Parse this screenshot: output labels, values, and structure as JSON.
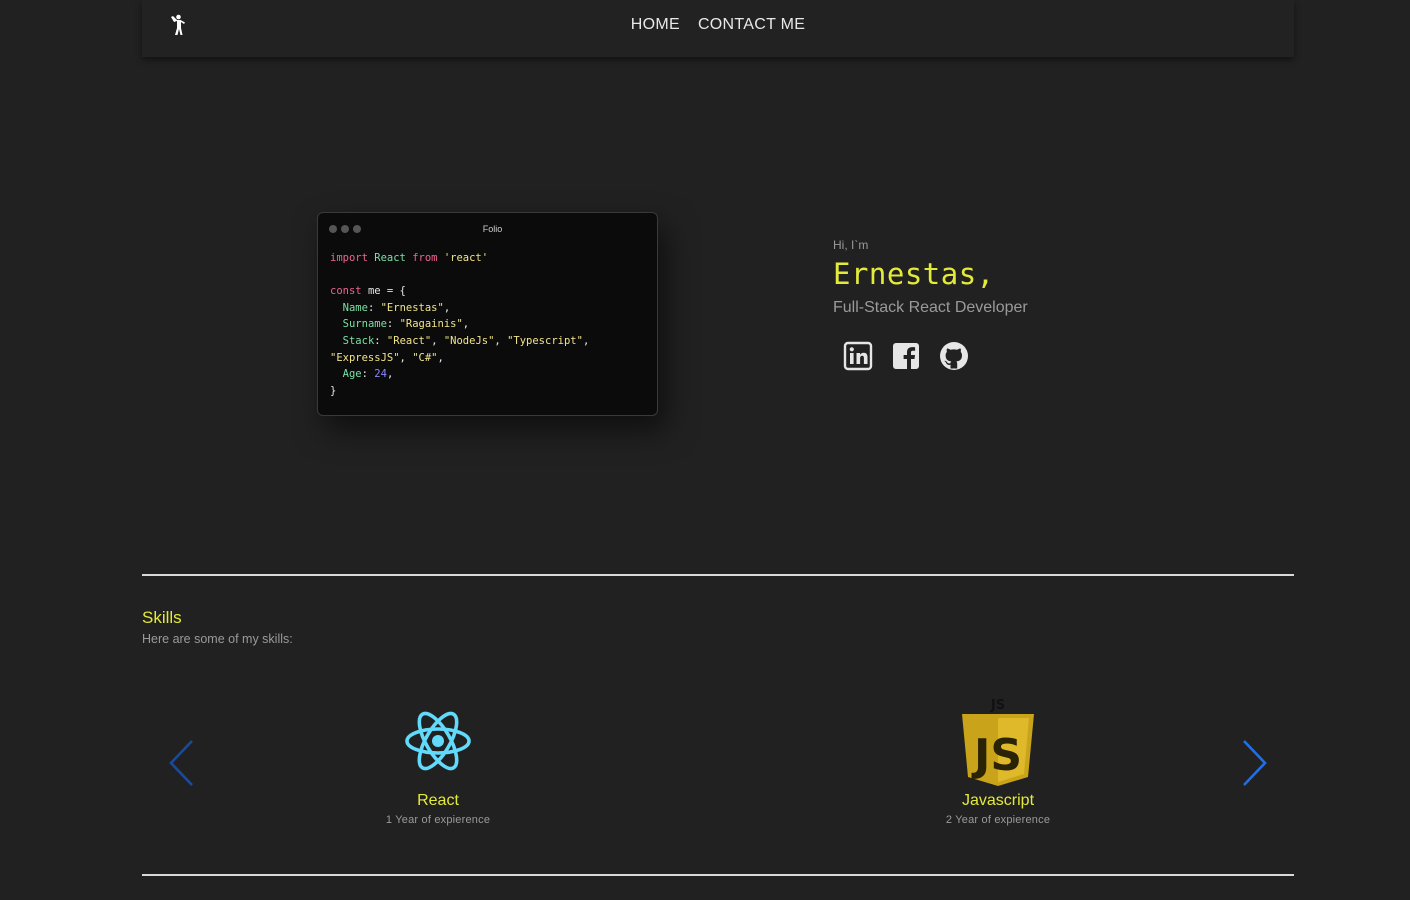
{
  "nav": {
    "logo_icon": "dancing-person-icon",
    "links": [
      {
        "label": "HOME"
      },
      {
        "label": "CONTACT ME"
      }
    ]
  },
  "code_window": {
    "title": "Folio",
    "lines": {
      "import_kw": "import",
      "import_name": "React",
      "from_kw": "from",
      "import_path": "'react'",
      "const_kw": "const",
      "var_name": "me",
      "name_key": "Name",
      "name_val": "\"Ernestas\"",
      "surname_key": "Surname",
      "surname_val": "\"Ragainis\"",
      "stack_key": "Stack",
      "stack_val1": "\"React\"",
      "stack_val2": "\"NodeJs\"",
      "stack_val3": "\"Typescript\"",
      "stack_val4": "\"ExpressJS\"",
      "stack_val5": "\"C#\"",
      "age_key": "Age",
      "age_val": "24"
    }
  },
  "intro": {
    "greeting": "Hi, I`m",
    "name": "Ernestas,",
    "role": "Full-Stack React Developer",
    "socials": [
      {
        "icon": "linkedin-icon"
      },
      {
        "icon": "facebook-icon"
      },
      {
        "icon": "github-icon"
      }
    ]
  },
  "skills": {
    "title": "Skills",
    "subtitle": "Here are some of my skills:",
    "items": [
      {
        "name": "React",
        "experience": "1 Year of expierence",
        "icon": "react-logo-icon"
      },
      {
        "name": "Javascript",
        "experience": "2 Year of expierence",
        "icon": "javascript-logo-icon"
      }
    ],
    "prev_icon": "chevron-left-icon",
    "next_icon": "chevron-right-icon"
  },
  "colors": {
    "background": "#212121",
    "accent": "#e4ea3a",
    "react": "#61dafb",
    "javascript": "#c9a41a",
    "arrow_prev": "#1a4a9a",
    "arrow_next": "#1f6fea"
  }
}
